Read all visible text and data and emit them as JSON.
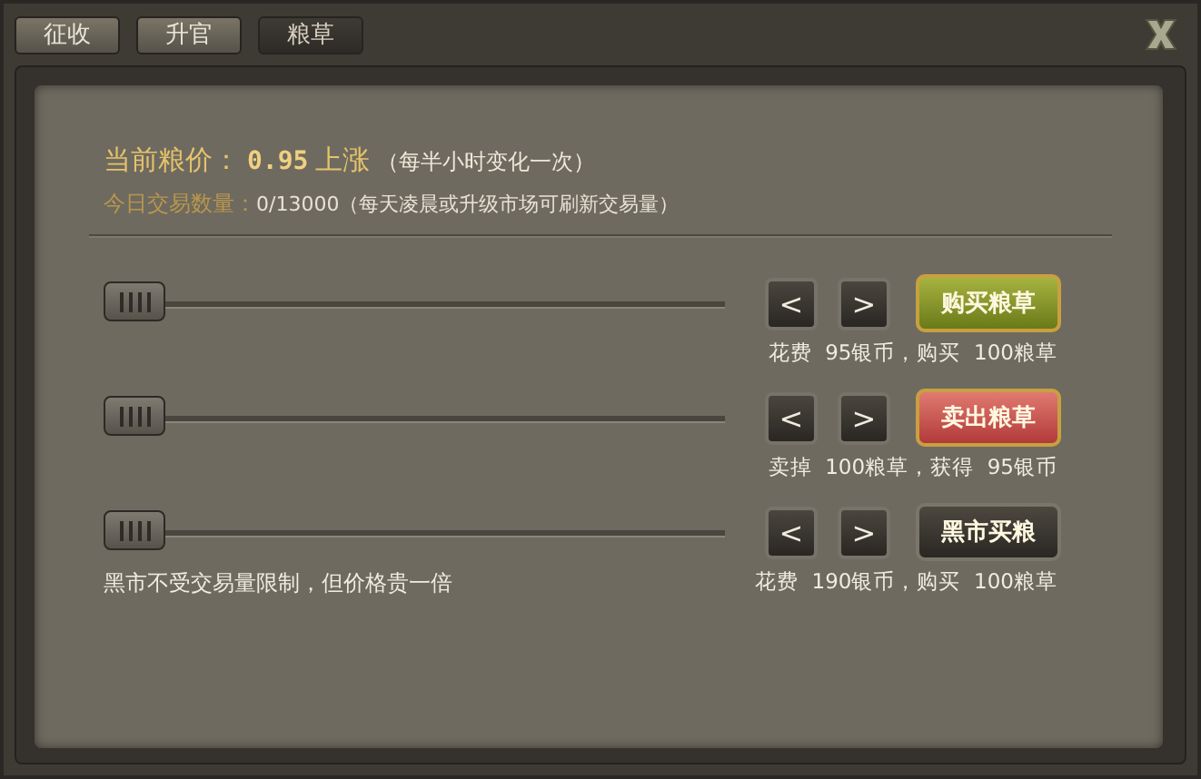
{
  "tabs": [
    {
      "label": "征收",
      "selected": false
    },
    {
      "label": "升官",
      "selected": false
    },
    {
      "label": "粮草",
      "selected": true
    }
  ],
  "price": {
    "label": "当前粮价：",
    "value": "0.95",
    "trend": "上涨",
    "note": "（每半小时变化一次）"
  },
  "volume": {
    "label": "今日交易数量：",
    "value": "0/13000",
    "note": "（每天凌晨或升级市场可刷新交易量）"
  },
  "trades": [
    {
      "kind": "buy",
      "prev": "<",
      "next": ">",
      "action": "购买粮草",
      "caption": "花费  95银币，购买  100粮草"
    },
    {
      "kind": "sell",
      "prev": "<",
      "next": ">",
      "action": "卖出粮草",
      "caption": "卖掉  100粮草，获得  95银币"
    },
    {
      "kind": "black",
      "prev": "<",
      "next": ">",
      "action": "黑市买粮",
      "caption": "花费  190银币，购买  100粮草",
      "note": "黑市不受交易量限制，但价格贵一倍"
    }
  ]
}
